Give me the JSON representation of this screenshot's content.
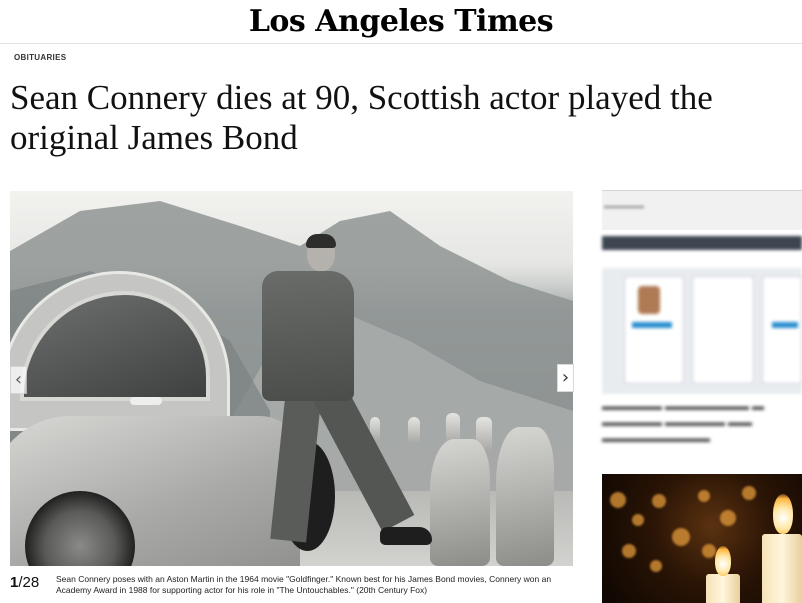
{
  "masthead": {
    "logo": "Los Angeles Times"
  },
  "article": {
    "section": "OBITUARIES",
    "headline": "Sean Connery dies at 90, Scottish actor played the original James Bond"
  },
  "gallery": {
    "current": "1",
    "total": "/28",
    "caption": "Sean Connery poses with an Aston Martin in the 1964 movie \"Goldfinger.\" Known best for his James Bond movies, Connery won an Academy Award in 1988 for supporting actor for his role in \"The Untouchables.\"  (20th Century Fox)",
    "prev_icon": "‹",
    "next_icon": "›"
  },
  "colors": {
    "text": "#111111",
    "rule": "#e2e2e2"
  },
  "icons": {
    "prev": "chevron-left-icon",
    "next": "chevron-right-icon"
  }
}
